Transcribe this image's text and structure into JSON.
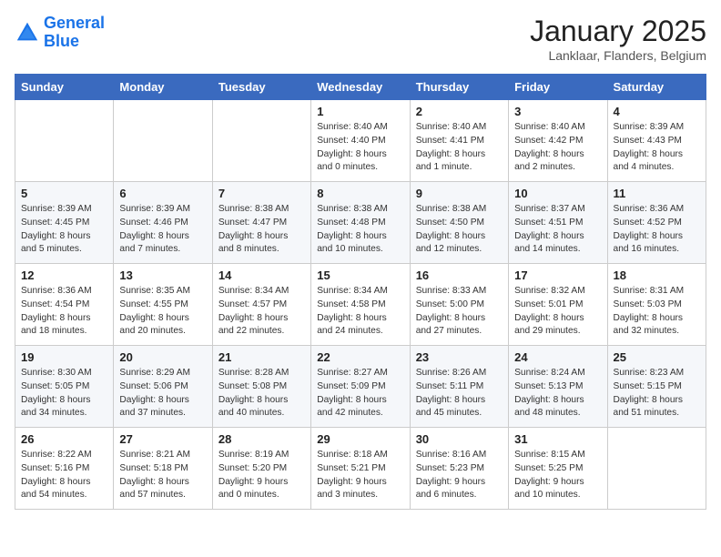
{
  "header": {
    "logo_line1": "General",
    "logo_line2": "Blue",
    "month_year": "January 2025",
    "location": "Lanklaar, Flanders, Belgium"
  },
  "weekdays": [
    "Sunday",
    "Monday",
    "Tuesday",
    "Wednesday",
    "Thursday",
    "Friday",
    "Saturday"
  ],
  "weeks": [
    [
      {
        "day": "",
        "content": ""
      },
      {
        "day": "",
        "content": ""
      },
      {
        "day": "",
        "content": ""
      },
      {
        "day": "1",
        "content": "Sunrise: 8:40 AM\nSunset: 4:40 PM\nDaylight: 8 hours\nand 0 minutes."
      },
      {
        "day": "2",
        "content": "Sunrise: 8:40 AM\nSunset: 4:41 PM\nDaylight: 8 hours\nand 1 minute."
      },
      {
        "day": "3",
        "content": "Sunrise: 8:40 AM\nSunset: 4:42 PM\nDaylight: 8 hours\nand 2 minutes."
      },
      {
        "day": "4",
        "content": "Sunrise: 8:39 AM\nSunset: 4:43 PM\nDaylight: 8 hours\nand 4 minutes."
      }
    ],
    [
      {
        "day": "5",
        "content": "Sunrise: 8:39 AM\nSunset: 4:45 PM\nDaylight: 8 hours\nand 5 minutes."
      },
      {
        "day": "6",
        "content": "Sunrise: 8:39 AM\nSunset: 4:46 PM\nDaylight: 8 hours\nand 7 minutes."
      },
      {
        "day": "7",
        "content": "Sunrise: 8:38 AM\nSunset: 4:47 PM\nDaylight: 8 hours\nand 8 minutes."
      },
      {
        "day": "8",
        "content": "Sunrise: 8:38 AM\nSunset: 4:48 PM\nDaylight: 8 hours\nand 10 minutes."
      },
      {
        "day": "9",
        "content": "Sunrise: 8:38 AM\nSunset: 4:50 PM\nDaylight: 8 hours\nand 12 minutes."
      },
      {
        "day": "10",
        "content": "Sunrise: 8:37 AM\nSunset: 4:51 PM\nDaylight: 8 hours\nand 14 minutes."
      },
      {
        "day": "11",
        "content": "Sunrise: 8:36 AM\nSunset: 4:52 PM\nDaylight: 8 hours\nand 16 minutes."
      }
    ],
    [
      {
        "day": "12",
        "content": "Sunrise: 8:36 AM\nSunset: 4:54 PM\nDaylight: 8 hours\nand 18 minutes."
      },
      {
        "day": "13",
        "content": "Sunrise: 8:35 AM\nSunset: 4:55 PM\nDaylight: 8 hours\nand 20 minutes."
      },
      {
        "day": "14",
        "content": "Sunrise: 8:34 AM\nSunset: 4:57 PM\nDaylight: 8 hours\nand 22 minutes."
      },
      {
        "day": "15",
        "content": "Sunrise: 8:34 AM\nSunset: 4:58 PM\nDaylight: 8 hours\nand 24 minutes."
      },
      {
        "day": "16",
        "content": "Sunrise: 8:33 AM\nSunset: 5:00 PM\nDaylight: 8 hours\nand 27 minutes."
      },
      {
        "day": "17",
        "content": "Sunrise: 8:32 AM\nSunset: 5:01 PM\nDaylight: 8 hours\nand 29 minutes."
      },
      {
        "day": "18",
        "content": "Sunrise: 8:31 AM\nSunset: 5:03 PM\nDaylight: 8 hours\nand 32 minutes."
      }
    ],
    [
      {
        "day": "19",
        "content": "Sunrise: 8:30 AM\nSunset: 5:05 PM\nDaylight: 8 hours\nand 34 minutes."
      },
      {
        "day": "20",
        "content": "Sunrise: 8:29 AM\nSunset: 5:06 PM\nDaylight: 8 hours\nand 37 minutes."
      },
      {
        "day": "21",
        "content": "Sunrise: 8:28 AM\nSunset: 5:08 PM\nDaylight: 8 hours\nand 40 minutes."
      },
      {
        "day": "22",
        "content": "Sunrise: 8:27 AM\nSunset: 5:09 PM\nDaylight: 8 hours\nand 42 minutes."
      },
      {
        "day": "23",
        "content": "Sunrise: 8:26 AM\nSunset: 5:11 PM\nDaylight: 8 hours\nand 45 minutes."
      },
      {
        "day": "24",
        "content": "Sunrise: 8:24 AM\nSunset: 5:13 PM\nDaylight: 8 hours\nand 48 minutes."
      },
      {
        "day": "25",
        "content": "Sunrise: 8:23 AM\nSunset: 5:15 PM\nDaylight: 8 hours\nand 51 minutes."
      }
    ],
    [
      {
        "day": "26",
        "content": "Sunrise: 8:22 AM\nSunset: 5:16 PM\nDaylight: 8 hours\nand 54 minutes."
      },
      {
        "day": "27",
        "content": "Sunrise: 8:21 AM\nSunset: 5:18 PM\nDaylight: 8 hours\nand 57 minutes."
      },
      {
        "day": "28",
        "content": "Sunrise: 8:19 AM\nSunset: 5:20 PM\nDaylight: 9 hours\nand 0 minutes."
      },
      {
        "day": "29",
        "content": "Sunrise: 8:18 AM\nSunset: 5:21 PM\nDaylight: 9 hours\nand 3 minutes."
      },
      {
        "day": "30",
        "content": "Sunrise: 8:16 AM\nSunset: 5:23 PM\nDaylight: 9 hours\nand 6 minutes."
      },
      {
        "day": "31",
        "content": "Sunrise: 8:15 AM\nSunset: 5:25 PM\nDaylight: 9 hours\nand 10 minutes."
      },
      {
        "day": "",
        "content": ""
      }
    ]
  ]
}
